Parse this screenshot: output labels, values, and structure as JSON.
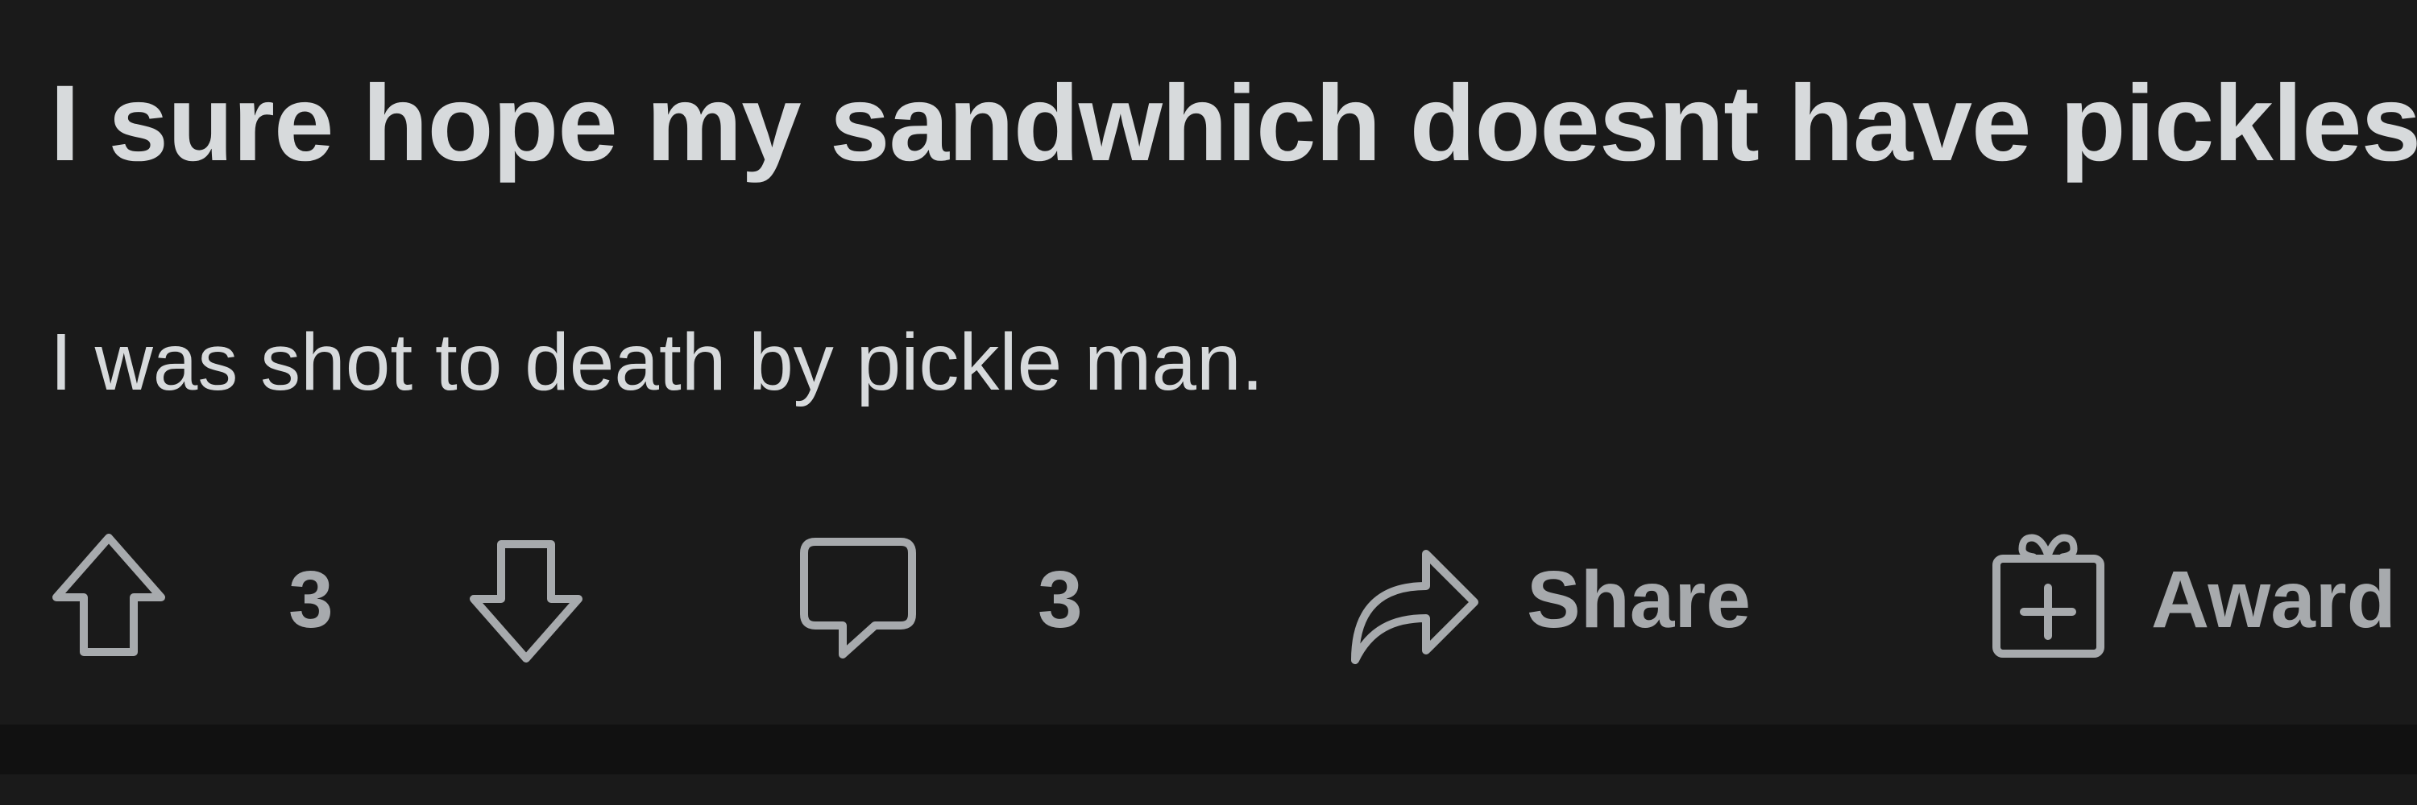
{
  "post": {
    "title": "I sure hope my sandwhich doesnt have pickles",
    "body": "I was shot to death by pickle man."
  },
  "actions": {
    "upvote_icon": "arrow-up-icon",
    "vote_count": "3",
    "downvote_icon": "arrow-down-icon",
    "comment_icon": "speech-bubble-icon",
    "comment_count": "3",
    "share_icon": "share-arrow-icon",
    "share_label": "Share",
    "award_icon": "gift-box-icon",
    "award_label": "Award"
  },
  "colors": {
    "background": "#1a1a1a",
    "separator": "#111111",
    "title_text": "#d7dadc",
    "action_text": "#a7aaad"
  }
}
